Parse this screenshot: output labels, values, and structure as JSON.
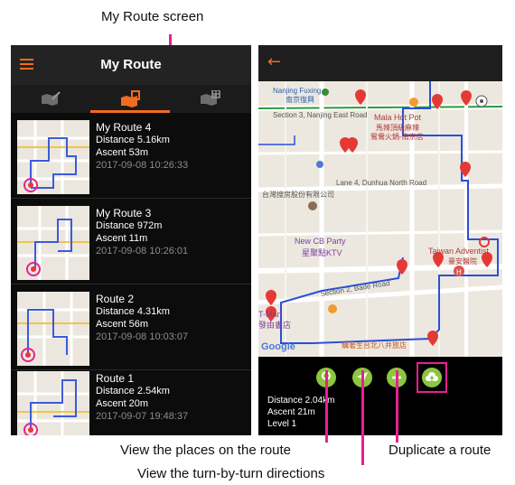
{
  "captions": {
    "top": "My Route screen",
    "places": "View the places on the route",
    "directions": "View the turn-by-turn directions",
    "duplicate": "Duplicate a route"
  },
  "list_screen": {
    "title": "My Route",
    "routes": [
      {
        "name": "My Route 4",
        "distance": "Distance  5.16km",
        "ascent": "Ascent  53m",
        "date": "2017-09-08 10:26:33"
      },
      {
        "name": "My Route 3",
        "distance": "Distance  972m",
        "ascent": "Ascent  11m",
        "date": "2017-09-08 10:26:01"
      },
      {
        "name": "Route 2",
        "distance": "Distance  4.31km",
        "ascent": "Ascent  56m",
        "date": "2017-09-08 10:03:07"
      },
      {
        "name": "Route 1",
        "distance": "Distance  2.54km",
        "ascent": "Ascent  20m",
        "date": "2017-09-07 19:48:37"
      }
    ]
  },
  "detail_screen": {
    "map_labels": {
      "nanjing": "Nanjing Fuxing",
      "nanjing_cn": "南京復興",
      "section3": "Section 3, Nanjing East Road",
      "mala": "Mala Hot Pot",
      "mala_cn1": "馬辣頂級麻辣",
      "mala_cn2": "鴛鴦火鍋-南京店",
      "lane4": "Lane 4, Dunhua North Road",
      "tw_corp": "台灣搜房股份有限公司",
      "cb_party": "New CB Party",
      "cb_party_cn": "星聚點KTV",
      "taiwan_adv": "Taiwan Adventist",
      "taiwan_adv_cn": "臺安醫院",
      "section2": "Section 2, Bade Road",
      "tmart": "T-Mart",
      "tmart_cn": "發由書店",
      "taipei": "購著生台北八井旅店",
      "google": "Google"
    },
    "stats": {
      "distance": "Distance  2.04km",
      "ascent": "Ascent  21m",
      "level": "Level  1"
    }
  },
  "colors": {
    "accent": "#f26b21",
    "callout": "#e8208f",
    "action_green": "#8dc63f",
    "route_blue": "#2a4fd8",
    "marker_red": "#e53935"
  }
}
